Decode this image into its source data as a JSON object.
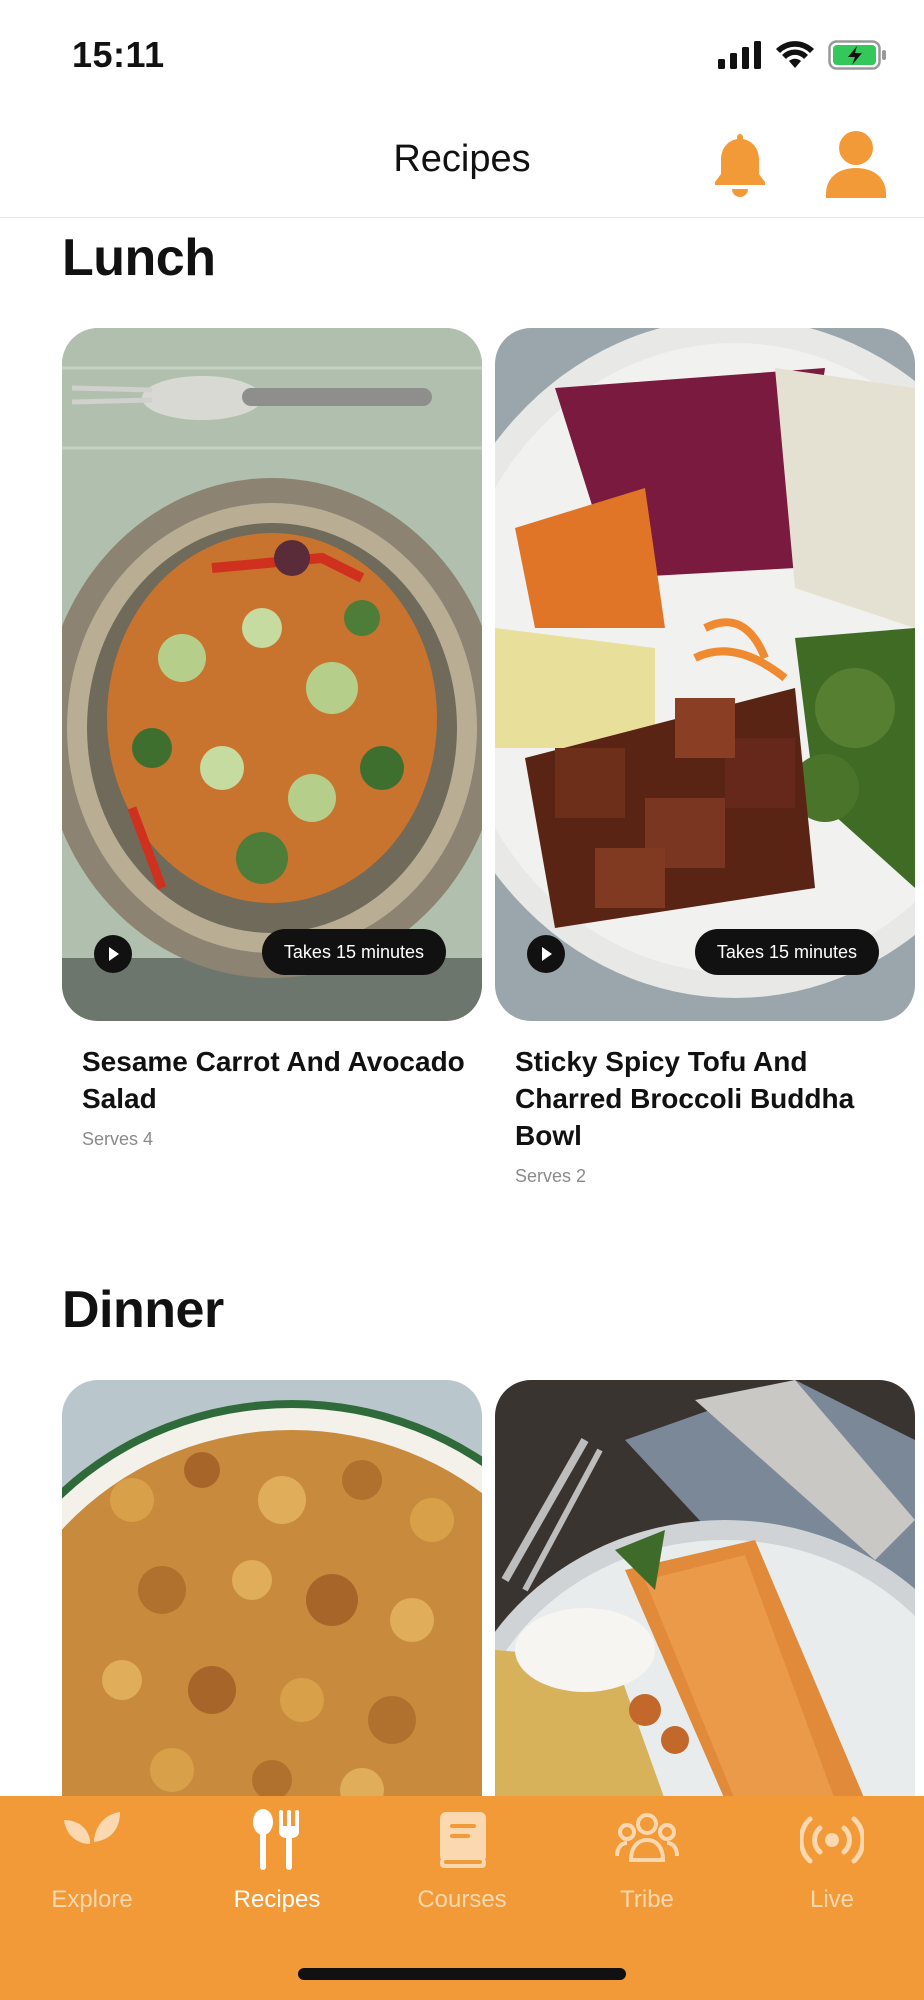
{
  "status_bar": {
    "time": "15:11",
    "battery_color": "#34c759"
  },
  "header": {
    "title": "Recipes",
    "accent_color": "#f39a38"
  },
  "sections": [
    {
      "title": "Lunch",
      "cards": [
        {
          "title": "Sesame Carrot And Avocado Salad",
          "serves": "Serves 4",
          "duration": "Takes 15 minutes",
          "image_icon": "salad-bowl-photo"
        },
        {
          "title": "Sticky Spicy Tofu And Charred Broccoli Buddha Bowl",
          "serves": "Serves 2",
          "duration": "Takes 15 minutes",
          "image_icon": "buddha-bowl-photo"
        }
      ]
    },
    {
      "title": "Dinner",
      "cards": [
        {
          "image_icon": "crumble-photo"
        },
        {
          "image_icon": "crepe-photo"
        }
      ]
    }
  ],
  "tab_bar": {
    "tabs": [
      {
        "label": "Explore",
        "icon": "sprout-icon",
        "active": false
      },
      {
        "label": "Recipes",
        "icon": "fork-spoon-icon",
        "active": true
      },
      {
        "label": "Courses",
        "icon": "book-icon",
        "active": false
      },
      {
        "label": "Tribe",
        "icon": "people-icon",
        "active": false
      },
      {
        "label": "Live",
        "icon": "broadcast-icon",
        "active": false
      }
    ]
  }
}
